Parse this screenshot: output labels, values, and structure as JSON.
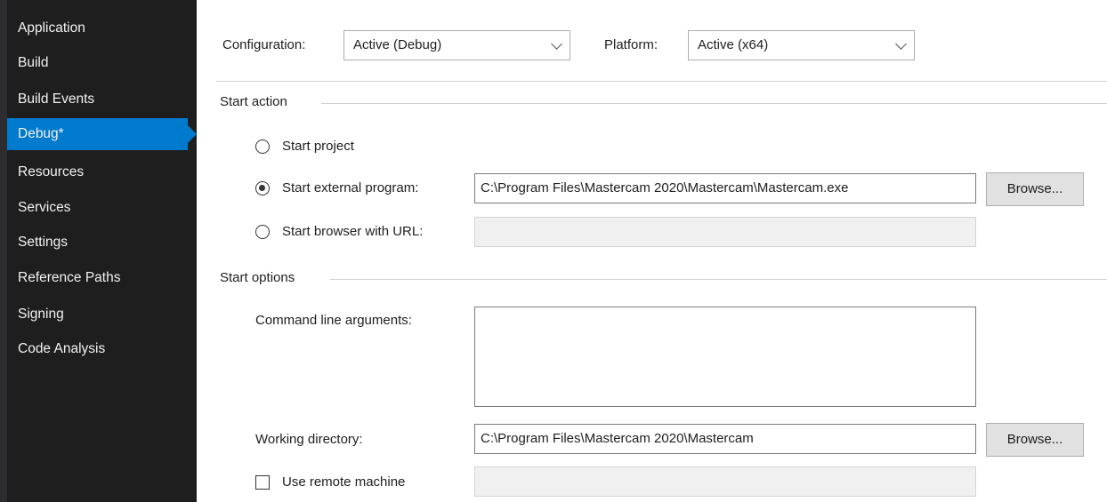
{
  "sidebar": {
    "items": [
      {
        "label": "Application"
      },
      {
        "label": "Build"
      },
      {
        "label": "Build Events"
      },
      {
        "label": "Debug*"
      },
      {
        "label": "Resources"
      },
      {
        "label": "Services"
      },
      {
        "label": "Settings"
      },
      {
        "label": "Reference Paths"
      },
      {
        "label": "Signing"
      },
      {
        "label": "Code Analysis"
      }
    ],
    "active_index": 3
  },
  "header": {
    "configuration_label": "Configuration:",
    "configuration_value": "Active (Debug)",
    "platform_label": "Platform:",
    "platform_value": "Active (x64)"
  },
  "start_action": {
    "heading": "Start action",
    "start_project_label": "Start project",
    "start_external_label": "Start external program:",
    "external_program_value": "C:\\Program Files\\Mastercam 2020\\Mastercam\\Mastercam.exe",
    "browse_label": "Browse...",
    "start_browser_label": "Start browser with URL:",
    "browser_url_value": "",
    "selected": "start_external"
  },
  "start_options": {
    "heading": "Start options",
    "command_line_label": "Command line arguments:",
    "command_line_value": "",
    "working_directory_label": "Working directory:",
    "working_directory_value": "C:\\Program Files\\Mastercam 2020\\Mastercam",
    "browse_label": "Browse...",
    "remote_machine_label": "Use remote machine",
    "remote_machine_checked": false,
    "remote_machine_value": ""
  },
  "colors": {
    "sidebar_bg": "#1e1e1e",
    "accent": "#007acc"
  }
}
